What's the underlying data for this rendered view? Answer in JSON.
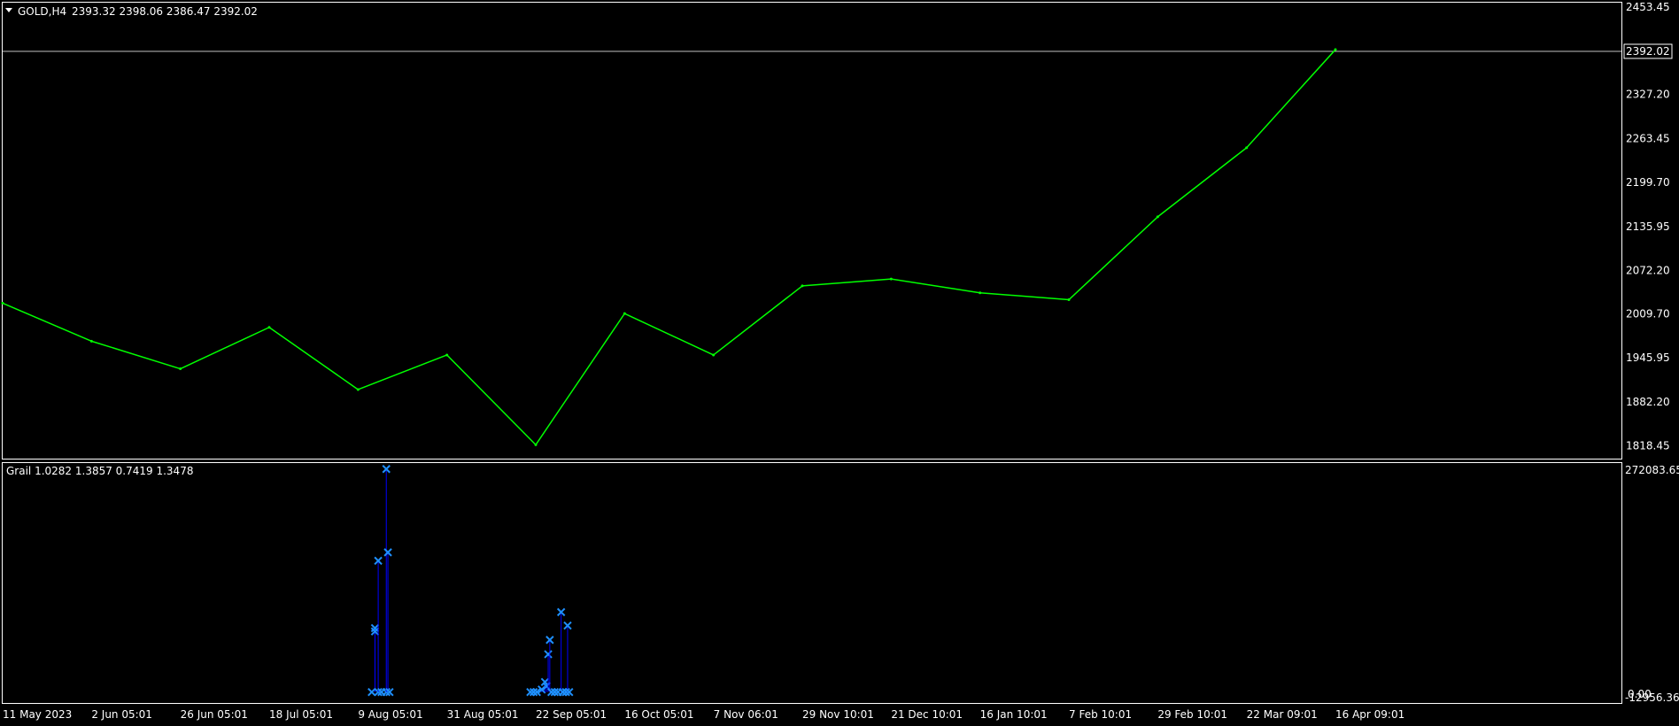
{
  "main_pane": {
    "symbol_label": "GOLD,H4",
    "ohlc_label": "2393.32 2398.06 2386.47 2392.02",
    "current_price_label": "2392.02"
  },
  "indicator_pane": {
    "label": "Grail 1.0282 1.3857 0.7419 1.3478",
    "y_top_label": "272083.65",
    "y_zero_label": "0.00",
    "y_bottom_label": "-12956.36"
  },
  "colors": {
    "background": "#000000",
    "price_line": "#00ff00",
    "indicator_line": "#0000ff",
    "indicator_marker": "#1e90ff",
    "grid_text": "#ffffff"
  },
  "chart_data": [
    {
      "type": "line",
      "title": "GOLD,H4",
      "series": [
        {
          "name": "GOLD,H4",
          "x": [
            "11 May 2023",
            "2 Jun 05:01",
            "26 Jun 05:01",
            "18 Jul 05:01",
            "9 Aug 05:01",
            "31 Aug 05:01",
            "22 Sep 05:01",
            "16 Oct 05:01",
            "7 Nov 06:01",
            "29 Nov 10:01",
            "21 Dec 10:01",
            "16 Jan 10:01",
            "7 Feb 10:01",
            "29 Feb 10:01",
            "22 Mar 09:01",
            "16 Apr 09:01"
          ],
          "values": [
            2025,
            1970,
            1930,
            1990,
            1900,
            1950,
            1820,
            2010,
            1950,
            2050,
            2060,
            2040,
            2030,
            2150,
            2250,
            2392
          ]
        }
      ],
      "x_ticks": [
        "11 May 2023",
        "2 Jun 05:01",
        "26 Jun 05:01",
        "18 Jul 05:01",
        "9 Aug 05:01",
        "31 Aug 05:01",
        "22 Sep 05:01",
        "16 Oct 05:01",
        "7 Nov 06:01",
        "29 Nov 10:01",
        "21 Dec 10:01",
        "16 Jan 10:01",
        "7 Feb 10:01",
        "29 Feb 10:01",
        "22 Mar 09:01",
        "16 Apr 09:01"
      ],
      "y_ticks": [
        "2453.45",
        "2327.20",
        "2263.45",
        "2199.70",
        "2135.95",
        "2072.20",
        "2009.70",
        "1945.95",
        "1882.20",
        "1818.45"
      ],
      "ylim": [
        1800,
        2460
      ],
      "current_price": 2392.02
    },
    {
      "type": "scatter",
      "title": "Grail 1.0282 1.3857 0.7419 1.3478",
      "series": [
        {
          "name": "Grail",
          "points": [
            {
              "x": 0.228,
              "y": 0
            },
            {
              "x": 0.23,
              "y": 76000
            },
            {
              "x": 0.23,
              "y": 72000
            },
            {
              "x": 0.232,
              "y": 0
            },
            {
              "x": 0.232,
              "y": 156000
            },
            {
              "x": 0.234,
              "y": 0
            },
            {
              "x": 0.237,
              "y": 0
            },
            {
              "x": 0.237,
              "y": 265000
            },
            {
              "x": 0.238,
              "y": 166000
            },
            {
              "x": 0.239,
              "y": 0
            },
            {
              "x": 0.326,
              "y": 0
            },
            {
              "x": 0.328,
              "y": 0
            },
            {
              "x": 0.33,
              "y": 0
            },
            {
              "x": 0.333,
              "y": 3000
            },
            {
              "x": 0.335,
              "y": 12000
            },
            {
              "x": 0.336,
              "y": 7000
            },
            {
              "x": 0.337,
              "y": 45000
            },
            {
              "x": 0.338,
              "y": 62000
            },
            {
              "x": 0.339,
              "y": 0
            },
            {
              "x": 0.341,
              "y": 0
            },
            {
              "x": 0.343,
              "y": 0
            },
            {
              "x": 0.345,
              "y": 95000
            },
            {
              "x": 0.346,
              "y": 0
            },
            {
              "x": 0.348,
              "y": 0
            },
            {
              "x": 0.349,
              "y": 79000
            },
            {
              "x": 0.35,
              "y": 0
            }
          ]
        }
      ],
      "ylim": [
        -12956.36,
        272083.65
      ]
    }
  ]
}
